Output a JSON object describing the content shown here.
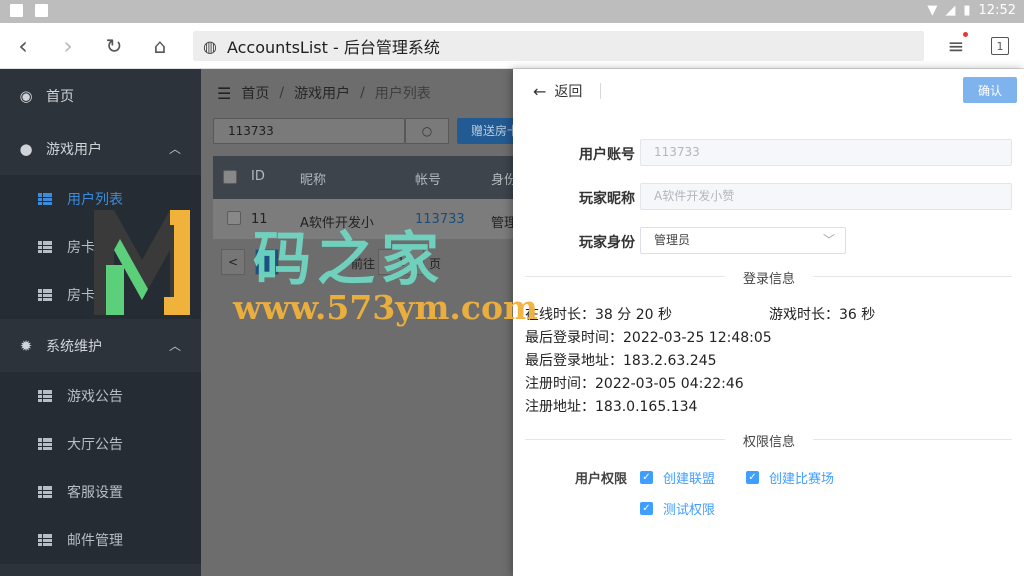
{
  "status_bar": {
    "time": "12:52"
  },
  "browser": {
    "url_title": "AccountsList - 后台管理系统",
    "tab_count": "1"
  },
  "sidebar": {
    "groups": [
      {
        "label": "首页"
      },
      {
        "label": "游戏用户",
        "items": [
          "用户列表",
          "房卡",
          "房卡"
        ]
      },
      {
        "label": "系统维护",
        "items": [
          "游戏公告",
          "大厅公告",
          "客服设置",
          "邮件管理"
        ]
      }
    ]
  },
  "main": {
    "breadcrumb": [
      "首页",
      "游戏用户",
      "用户列表"
    ],
    "search_value": "113733",
    "gift_button": "赠送房卡",
    "table": {
      "headers": [
        "ID",
        "昵称",
        "帐号",
        "身份"
      ],
      "rows": [
        {
          "id": "11",
          "nickname": "A软件开发小",
          "account": "113733",
          "role": "管理"
        }
      ]
    },
    "pager": {
      "prev": "<",
      "page": "1",
      "page_label": "页",
      "goto_label": "前往"
    }
  },
  "panel": {
    "back_label": "返回",
    "confirm_label": "确认",
    "fields": {
      "account_label": "用户账号",
      "account_value": "113733",
      "nickname_label": "玩家昵称",
      "nickname_value": "A软件开发小赞",
      "role_label": "玩家身份",
      "role_value": "管理员"
    },
    "login_section_title": "登录信息",
    "login_info": {
      "online_label": "在线时长：",
      "online_value": "38 分 20 秒",
      "game_label": "游戏时长：",
      "game_value": "36 秒",
      "last_login_time_label": "最后登录时间：",
      "last_login_time": "2022-03-25 12:48:05",
      "last_login_addr_label": "最后登录地址：",
      "last_login_addr": "183.2.63.245",
      "reg_time_label": "注册时间：",
      "reg_time": "2022-03-05 04:22:46",
      "reg_addr_label": "注册地址：",
      "reg_addr": "183.0.165.134"
    },
    "perm_section_title": "权限信息",
    "perm_label": "用户权限",
    "permissions": [
      "创建联盟",
      "创建比赛场",
      "测试权限"
    ]
  },
  "watermark": {
    "cn": "码之家",
    "url": "www.573ym.com"
  }
}
